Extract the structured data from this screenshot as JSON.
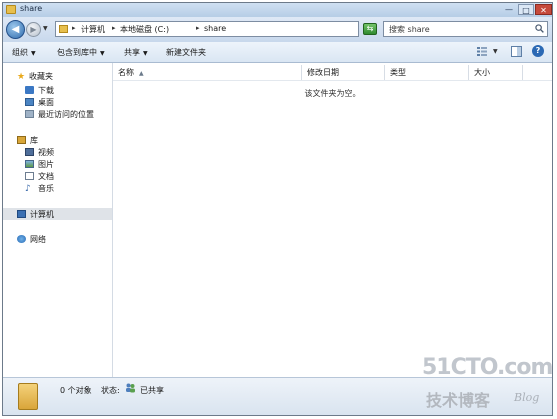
{
  "window": {
    "title": "share"
  },
  "address_bar": {
    "crumbs": [
      "计算机",
      "本地磁盘 (C:)",
      "share"
    ]
  },
  "search": {
    "placeholder": "搜索 share"
  },
  "commands": [
    {
      "label": "组织",
      "dropdown": true
    },
    {
      "label": "包含到库中",
      "dropdown": true
    },
    {
      "label": "共享",
      "dropdown": true
    },
    {
      "label": "新建文件夹",
      "dropdown": false
    }
  ],
  "nav": {
    "favorites": {
      "label": "收藏夹",
      "items": [
        "下载",
        "桌面",
        "最近访问的位置"
      ]
    },
    "libraries": {
      "label": "库",
      "items": [
        "视频",
        "图片",
        "文档",
        "音乐"
      ]
    },
    "computer": {
      "label": "计算机",
      "selected": true
    },
    "network": {
      "label": "网络"
    }
  },
  "columns": [
    "名称",
    "修改日期",
    "类型",
    "大小"
  ],
  "content": {
    "empty_message": "该文件夹为空。"
  },
  "details": {
    "count": "0 个对象",
    "state_label": "状态:",
    "state_value": "已共享"
  },
  "watermark": {
    "main": "51CTO.com",
    "sub": "技术博客",
    "blog": "Blog"
  },
  "colors": {
    "accent": "#2b69b4",
    "titlebar": "#c3d6ec",
    "close": "#c64a3c"
  }
}
